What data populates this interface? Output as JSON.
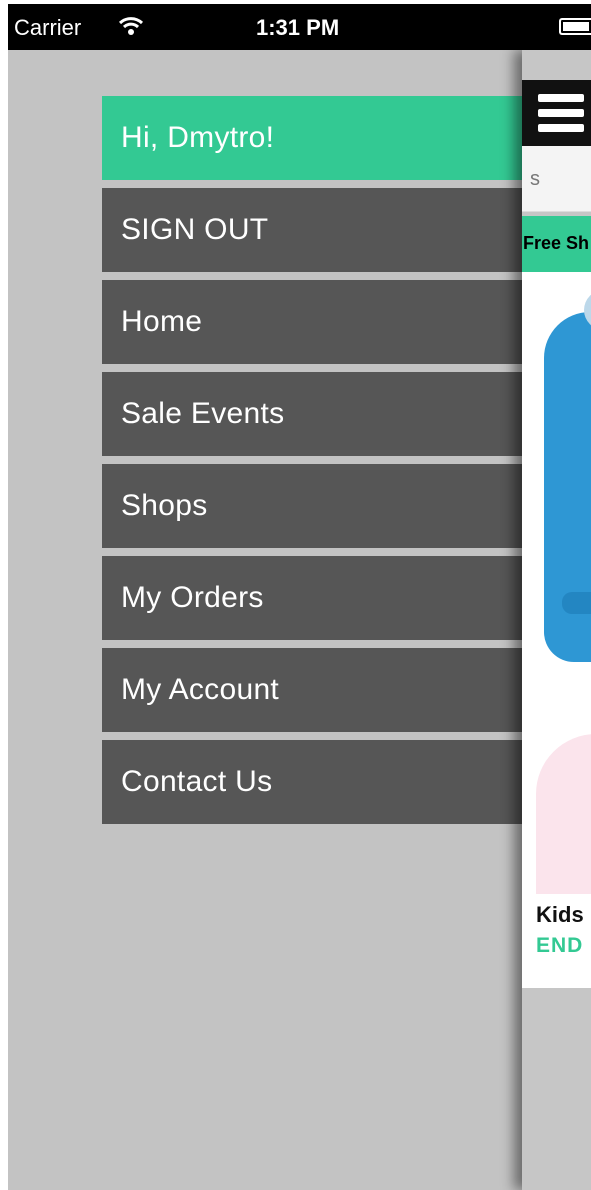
{
  "status_bar": {
    "carrier": "Carrier",
    "time": "1:31 PM",
    "wifi_icon": "wifi-icon",
    "battery_icon": "battery-icon"
  },
  "menu": {
    "greeting": "Hi, Dmytro!",
    "items": [
      {
        "label": "SIGN OUT"
      },
      {
        "label": "Home"
      },
      {
        "label": "Sale Events"
      },
      {
        "label": "Shops"
      },
      {
        "label": "My Orders"
      },
      {
        "label": "My Account"
      },
      {
        "label": "Contact Us"
      }
    ]
  },
  "content": {
    "menu_icon": "hamburger-icon",
    "search_text": "s",
    "promo_text": "Free Sh",
    "product_title": "Kids",
    "product_status": "END"
  },
  "colors": {
    "accent": "#33c993",
    "menu_item_bg": "#565656",
    "background": "#c3c3c3",
    "status_bar": "#000000"
  }
}
